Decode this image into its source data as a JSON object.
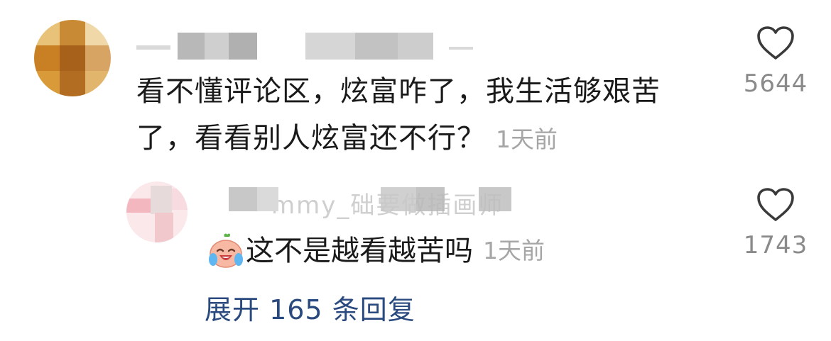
{
  "comment": {
    "username": "",
    "text_line1": "看不懂评论区，炫富咋了，我生活够艰苦",
    "text_line2": "了，看看别人炫富还不行？",
    "time": "1天前",
    "likes": "5644",
    "like_icon": "heart-outline-icon"
  },
  "reply": {
    "username": "mmy_础要做插画师",
    "emoji": "crying-laughing-peach-emoji",
    "text": "这不是越看越苦吗",
    "time": "1天前",
    "likes": "1743",
    "like_icon": "heart-outline-icon"
  },
  "expand_replies": "展开 165 条回复",
  "colors": {
    "text": "#1a1a1a",
    "time": "#a6a6a6",
    "link": "#2a4a7f",
    "count": "#8a8a8a"
  }
}
